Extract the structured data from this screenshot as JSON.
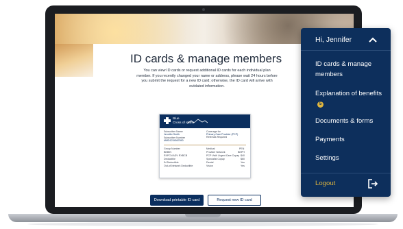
{
  "page": {
    "title": "ID cards & manage members",
    "description": "You can view ID cards or request additional ID cards for each individual plan member. If you recently changed your name or address, please wait 24 hours before you submit the request for a new ID card; otherwise, the ID card will arrive with outdated information."
  },
  "id_card": {
    "brand_line1": "Blue",
    "brand_line2": "Cross of Idaho",
    "subscriber_name_label": "Subscriber Name",
    "subscriber_name": "Jennifer Smith",
    "subscriber_number_label": "Subscriber Number",
    "subscriber_number": "MMD1234567890",
    "coverage_label": "Coverage for",
    "coverage_value": "Primary Care Provider (PCP)",
    "coverage_note": "Referrals Required",
    "left_rows": [
      "Group Number",
      "BNBIN",
      "RXPCN     ADV     RXBCB",
      "Deductible",
      "IN Deductible",
      "Out-of-Network Deductible"
    ],
    "right_rows": [
      {
        "label": "Medical",
        "value": "PEN"
      },
      {
        "label": "Provider Network",
        "value": "BNPH"
      },
      {
        "label": "PCP Visit/ Urgent Care Copay",
        "value": "$40"
      },
      {
        "label": "Specialist Copay",
        "value": "$60"
      },
      {
        "label": "Dental",
        "value": "Yes"
      },
      {
        "label": "Vision",
        "value": "Yes"
      }
    ]
  },
  "buttons": {
    "download": "Download printable ID card",
    "request": "Request new ID card"
  },
  "menu": {
    "greeting": "Hi, Jennifer",
    "items": [
      {
        "label": "ID cards & manage members"
      },
      {
        "label": "Explanation of benefits",
        "badge": "5"
      },
      {
        "label": "Documents & forms"
      },
      {
        "label": "Payments"
      },
      {
        "label": "Settings"
      }
    ],
    "logout": "Logout"
  },
  "colors": {
    "navy": "#0d2f5c",
    "gold": "#e0b63e"
  }
}
